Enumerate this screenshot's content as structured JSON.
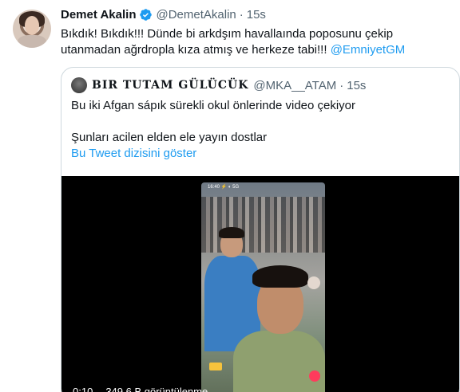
{
  "tweet": {
    "author_name": "Demet Akalin",
    "author_handle": "@DemetAkalin",
    "dot": "·",
    "time": "15s",
    "text_part1": "Bıkdık! Bıkdık!!! Dünde bi arkdşım havallaında poposunu çekip utanmadan ağrdropla kıza atmış ve herkeze tabi!!! ",
    "mention": "@EmniyetGM"
  },
  "quote": {
    "author_name": "BIR TUTAM GÜLÜCÜK",
    "author_handle": "@MKA__ATAM",
    "dot": "·",
    "time": "15s",
    "line1": "Bu iki Afgan sápık sürekli okul önlerinde video çekiyor",
    "line2": "Şunları acilen elden ele yayın dostlar",
    "thread_link": "Bu Tweet dizisini göster"
  },
  "video": {
    "duration": "0:10",
    "views": "349,6 B görüntülenme",
    "phone_status": "16:40 ⚡ ◐ 5G"
  },
  "colors": {
    "accent": "#1d9bf0",
    "text": "#0f1419",
    "muted": "#536471",
    "border": "#cfd9de"
  }
}
